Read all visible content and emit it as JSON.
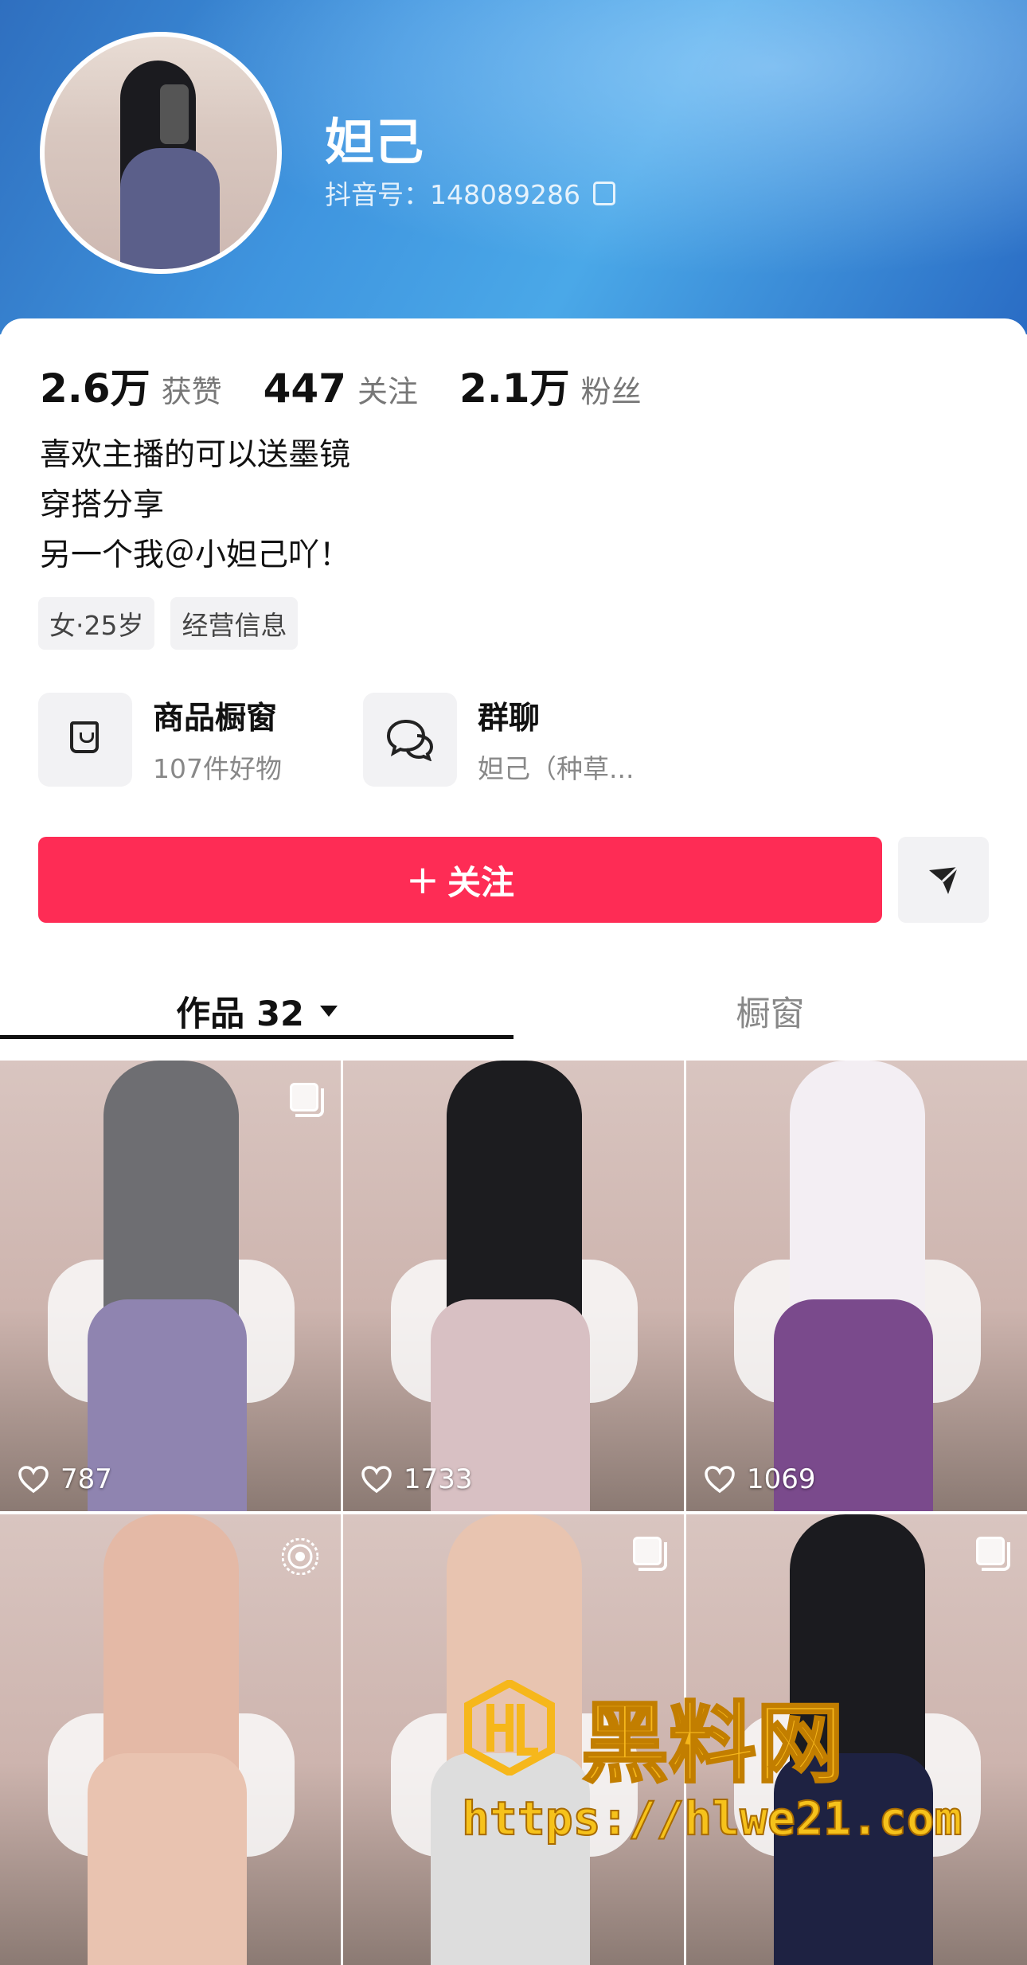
{
  "profile": {
    "name": "妲己",
    "douyin_id_label": "抖音号：",
    "douyin_id": "148089286"
  },
  "stats": [
    {
      "num": "2.6万",
      "label": "获赞"
    },
    {
      "num": "447",
      "label": "关注"
    },
    {
      "num": "2.1万",
      "label": "粉丝"
    }
  ],
  "bio": [
    "喜欢主播的可以送墨镜",
    "穿搭分享",
    "另一个我＠小妲己吖！"
  ],
  "tags": [
    "女·25岁",
    "经营信息"
  ],
  "features": {
    "shop": {
      "title": "商品橱窗",
      "sub": "107件好物"
    },
    "group": {
      "title": "群聊",
      "sub": "妲己（种草..."
    }
  },
  "actions": {
    "follow_plus": "+",
    "follow_label": "关注"
  },
  "tabs": {
    "works_label": "作品 32",
    "shop_label": "橱窗"
  },
  "posts": [
    {
      "likes": "787",
      "badge": "multi",
      "figure_color": "#6e6e72",
      "legs_color": "#8f84b0"
    },
    {
      "likes": "1733",
      "badge": "none",
      "figure_color": "#1c1c1f",
      "legs_color": "#d8c0c3"
    },
    {
      "likes": "1069",
      "badge": "none",
      "figure_color": "#f3eef3",
      "legs_color": "#7a4a8c"
    },
    {
      "likes": "",
      "badge": "live",
      "figure_color": "#e4b9a6",
      "legs_color": "#e9c3b0"
    },
    {
      "likes": "",
      "badge": "multi",
      "figure_color": "#e8c4b0",
      "legs_color": "#ddd"
    },
    {
      "likes": "",
      "badge": "multi",
      "figure_color": "#1b1b1f",
      "legs_color": "#1e2242"
    }
  ],
  "watermark": {
    "title": "黑料网",
    "url": "https://hlwe21.com"
  },
  "colors": {
    "accent": "#fe2c55",
    "muted": "#888888"
  }
}
